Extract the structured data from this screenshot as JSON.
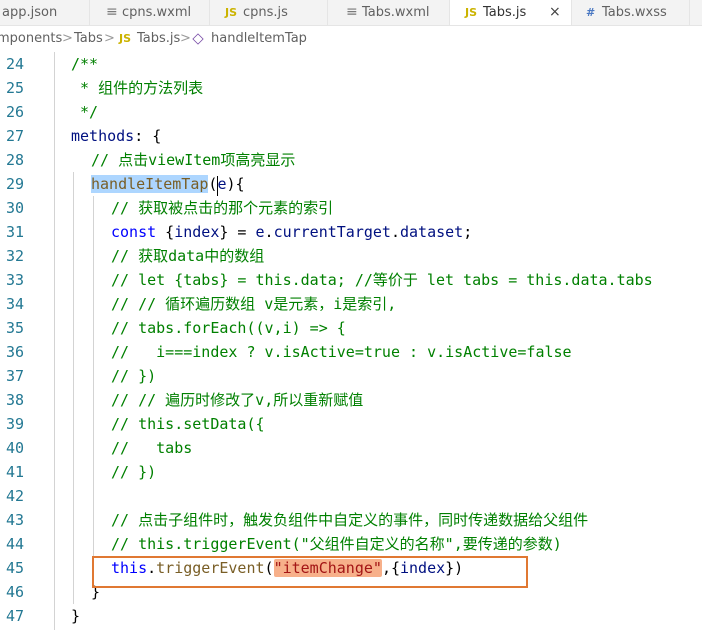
{
  "tabs": [
    {
      "icon": "json-file-icon",
      "icon_text": "{ }",
      "label": "app.json",
      "active": false
    },
    {
      "icon": "xml-file-icon",
      "icon_text": "≡",
      "label": "cpns.wxml",
      "active": false
    },
    {
      "icon": "js-file-icon",
      "icon_text": "JS",
      "label": "cpns.js",
      "active": false
    },
    {
      "icon": "xml-file-icon",
      "icon_text": "≡",
      "label": "Tabs.wxml",
      "active": false
    },
    {
      "icon": "js-file-icon",
      "icon_text": "JS",
      "label": "Tabs.js",
      "active": true,
      "close": "×"
    },
    {
      "icon": "css-file-icon",
      "icon_text": "#",
      "label": "Tabs.wxss",
      "active": false
    }
  ],
  "breadcrumb": {
    "part1": "mponents",
    "sep": ">",
    "part2": "Tabs",
    "file_icon": "JS",
    "part3": "Tabs.js",
    "part4": "handleItemTap"
  },
  "line_numbers": [
    "24",
    "25",
    "26",
    "27",
    "28",
    "29",
    "30",
    "31",
    "32",
    "33",
    "34",
    "35",
    "36",
    "37",
    "38",
    "39",
    "40",
    "41",
    "42",
    "43",
    "44",
    "45",
    "46",
    "47"
  ],
  "code": {
    "l24": "/**",
    "l25": " * 组件的方法列表",
    "l26": " */",
    "l27_a": "methods",
    "l27_b": ": {",
    "l28": "// 点击viewItem项高亮显示",
    "l29_a": "handleItemTap",
    "l29_b": "(",
    "l29_c": "e",
    "l29_d": "){",
    "l30": "// 获取被点击的那个元素的索引",
    "l31_a": "const",
    "l31_b": " {",
    "l31_c": "index",
    "l31_d": "} = ",
    "l31_e": "e",
    "l31_f": ".",
    "l31_g": "currentTarget",
    "l31_h": ".",
    "l31_i": "dataset",
    "l31_j": ";",
    "l32": "// 获取data中的数组",
    "l33": "// let {tabs} = this.data; //等价于 let tabs = this.data.tabs",
    "l34": "// // 循环遍历数组 v是元素，i是索引,",
    "l35": "// tabs.forEach((v,i) => {",
    "l36": "//   i===index ? v.isActive=true : v.isActive=false",
    "l37": "// })",
    "l38": "// // 遍历时修改了v,所以重新赋值",
    "l39": "// this.setData({",
    "l40": "//   tabs",
    "l41": "// })",
    "l43": "// 点击子组件时，触发负组件中自定义的事件，同时传递数据给父组件",
    "l44": "// this.triggerEvent(\"父组件自定义的名称\",要传递的参数)",
    "l45_a": "this",
    "l45_b": ".",
    "l45_c": "triggerEvent",
    "l45_d": "(",
    "l45_e": "\"itemChange\"",
    "l45_f": ",{",
    "l45_g": "index",
    "l45_h": "})",
    "l46": "}",
    "l47": "}"
  },
  "colors": {
    "comment": "#008000",
    "keyword": "#0000ff",
    "function": "#795e26",
    "string": "#a31515",
    "line_number": "#237893",
    "annotation_box": "#e07832"
  }
}
